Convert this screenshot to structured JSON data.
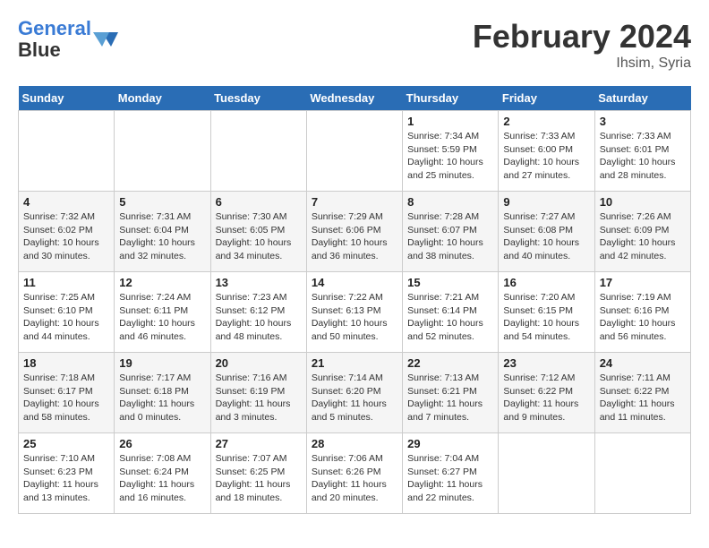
{
  "header": {
    "logo_line1": "General",
    "logo_line2": "Blue",
    "month_year": "February 2024",
    "location": "Ihsim, Syria"
  },
  "weekdays": [
    "Sunday",
    "Monday",
    "Tuesday",
    "Wednesday",
    "Thursday",
    "Friday",
    "Saturday"
  ],
  "weeks": [
    [
      {
        "day": "",
        "info": ""
      },
      {
        "day": "",
        "info": ""
      },
      {
        "day": "",
        "info": ""
      },
      {
        "day": "",
        "info": ""
      },
      {
        "day": "1",
        "info": "Sunrise: 7:34 AM\nSunset: 5:59 PM\nDaylight: 10 hours and 25 minutes."
      },
      {
        "day": "2",
        "info": "Sunrise: 7:33 AM\nSunset: 6:00 PM\nDaylight: 10 hours and 27 minutes."
      },
      {
        "day": "3",
        "info": "Sunrise: 7:33 AM\nSunset: 6:01 PM\nDaylight: 10 hours and 28 minutes."
      }
    ],
    [
      {
        "day": "4",
        "info": "Sunrise: 7:32 AM\nSunset: 6:02 PM\nDaylight: 10 hours and 30 minutes."
      },
      {
        "day": "5",
        "info": "Sunrise: 7:31 AM\nSunset: 6:04 PM\nDaylight: 10 hours and 32 minutes."
      },
      {
        "day": "6",
        "info": "Sunrise: 7:30 AM\nSunset: 6:05 PM\nDaylight: 10 hours and 34 minutes."
      },
      {
        "day": "7",
        "info": "Sunrise: 7:29 AM\nSunset: 6:06 PM\nDaylight: 10 hours and 36 minutes."
      },
      {
        "day": "8",
        "info": "Sunrise: 7:28 AM\nSunset: 6:07 PM\nDaylight: 10 hours and 38 minutes."
      },
      {
        "day": "9",
        "info": "Sunrise: 7:27 AM\nSunset: 6:08 PM\nDaylight: 10 hours and 40 minutes."
      },
      {
        "day": "10",
        "info": "Sunrise: 7:26 AM\nSunset: 6:09 PM\nDaylight: 10 hours and 42 minutes."
      }
    ],
    [
      {
        "day": "11",
        "info": "Sunrise: 7:25 AM\nSunset: 6:10 PM\nDaylight: 10 hours and 44 minutes."
      },
      {
        "day": "12",
        "info": "Sunrise: 7:24 AM\nSunset: 6:11 PM\nDaylight: 10 hours and 46 minutes."
      },
      {
        "day": "13",
        "info": "Sunrise: 7:23 AM\nSunset: 6:12 PM\nDaylight: 10 hours and 48 minutes."
      },
      {
        "day": "14",
        "info": "Sunrise: 7:22 AM\nSunset: 6:13 PM\nDaylight: 10 hours and 50 minutes."
      },
      {
        "day": "15",
        "info": "Sunrise: 7:21 AM\nSunset: 6:14 PM\nDaylight: 10 hours and 52 minutes."
      },
      {
        "day": "16",
        "info": "Sunrise: 7:20 AM\nSunset: 6:15 PM\nDaylight: 10 hours and 54 minutes."
      },
      {
        "day": "17",
        "info": "Sunrise: 7:19 AM\nSunset: 6:16 PM\nDaylight: 10 hours and 56 minutes."
      }
    ],
    [
      {
        "day": "18",
        "info": "Sunrise: 7:18 AM\nSunset: 6:17 PM\nDaylight: 10 hours and 58 minutes."
      },
      {
        "day": "19",
        "info": "Sunrise: 7:17 AM\nSunset: 6:18 PM\nDaylight: 11 hours and 0 minutes."
      },
      {
        "day": "20",
        "info": "Sunrise: 7:16 AM\nSunset: 6:19 PM\nDaylight: 11 hours and 3 minutes."
      },
      {
        "day": "21",
        "info": "Sunrise: 7:14 AM\nSunset: 6:20 PM\nDaylight: 11 hours and 5 minutes."
      },
      {
        "day": "22",
        "info": "Sunrise: 7:13 AM\nSunset: 6:21 PM\nDaylight: 11 hours and 7 minutes."
      },
      {
        "day": "23",
        "info": "Sunrise: 7:12 AM\nSunset: 6:22 PM\nDaylight: 11 hours and 9 minutes."
      },
      {
        "day": "24",
        "info": "Sunrise: 7:11 AM\nSunset: 6:22 PM\nDaylight: 11 hours and 11 minutes."
      }
    ],
    [
      {
        "day": "25",
        "info": "Sunrise: 7:10 AM\nSunset: 6:23 PM\nDaylight: 11 hours and 13 minutes."
      },
      {
        "day": "26",
        "info": "Sunrise: 7:08 AM\nSunset: 6:24 PM\nDaylight: 11 hours and 16 minutes."
      },
      {
        "day": "27",
        "info": "Sunrise: 7:07 AM\nSunset: 6:25 PM\nDaylight: 11 hours and 18 minutes."
      },
      {
        "day": "28",
        "info": "Sunrise: 7:06 AM\nSunset: 6:26 PM\nDaylight: 11 hours and 20 minutes."
      },
      {
        "day": "29",
        "info": "Sunrise: 7:04 AM\nSunset: 6:27 PM\nDaylight: 11 hours and 22 minutes."
      },
      {
        "day": "",
        "info": ""
      },
      {
        "day": "",
        "info": ""
      }
    ]
  ]
}
